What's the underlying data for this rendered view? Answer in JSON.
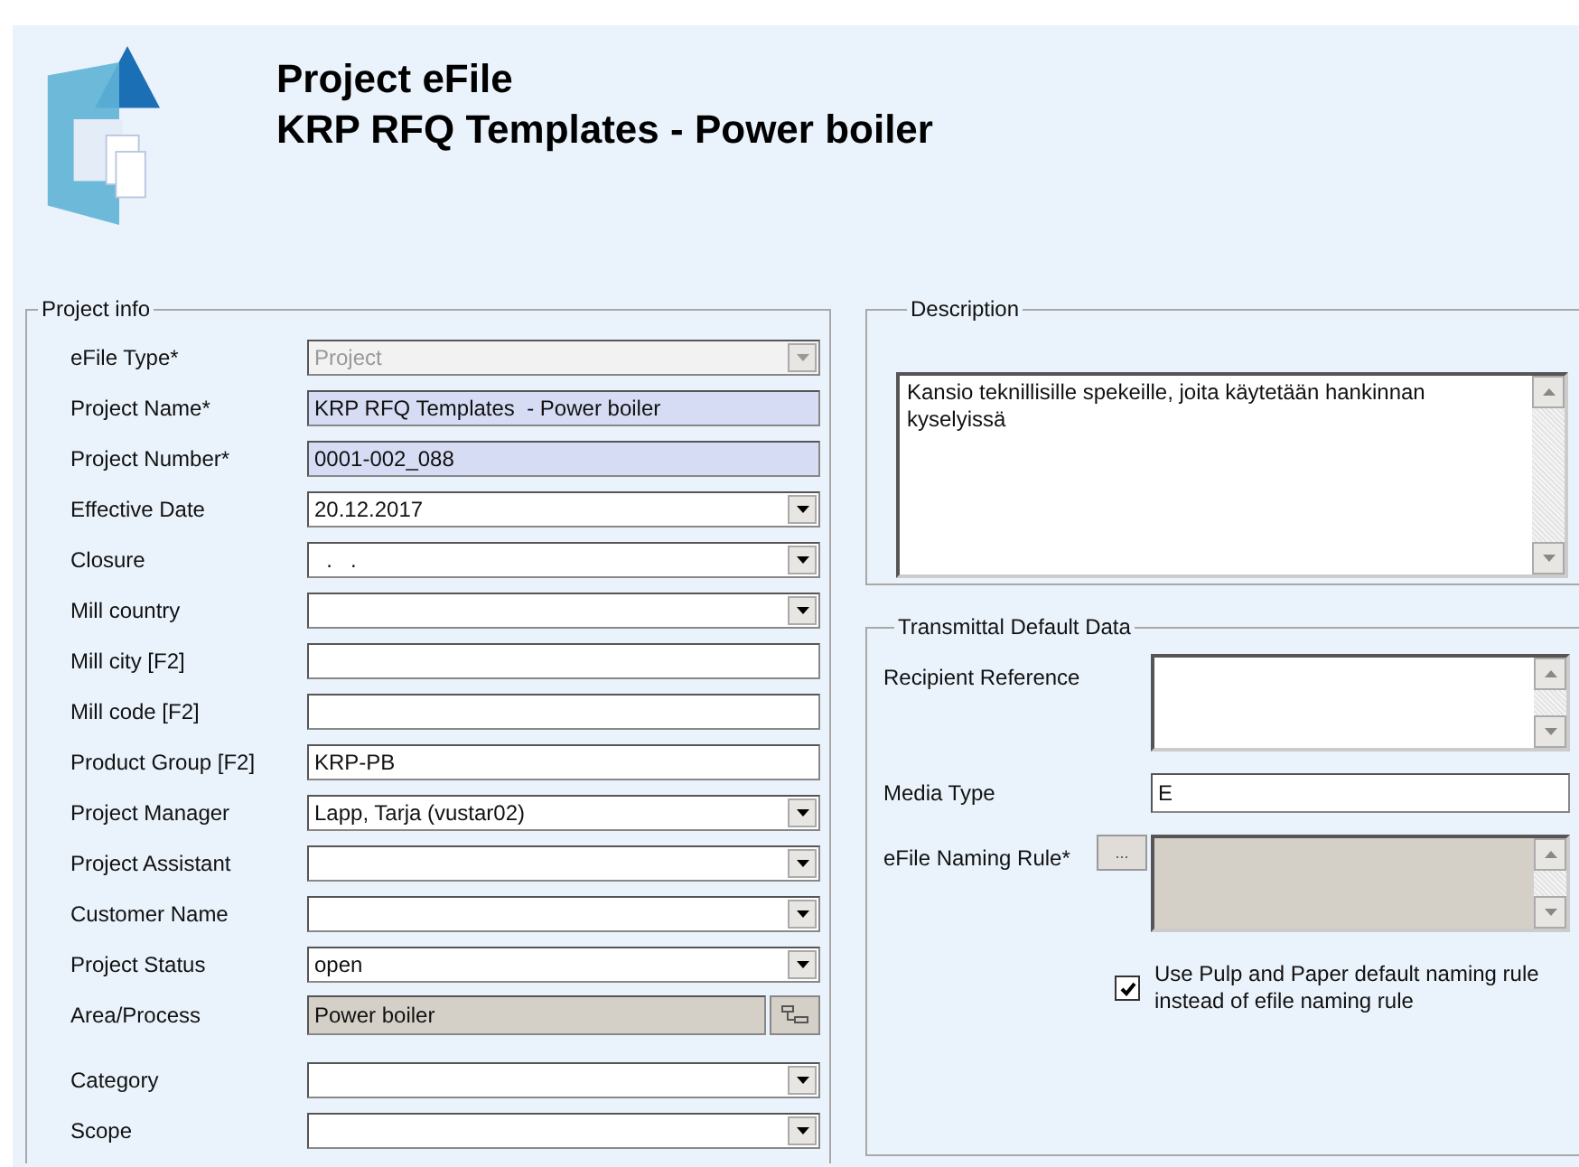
{
  "header": {
    "title": "Project eFile",
    "subtitle": "KRP RFQ Templates  - Power boiler"
  },
  "project_info": {
    "legend": "Project info",
    "fields": [
      {
        "label": "eFile Type*",
        "kind": "dropdown",
        "value": "Project",
        "disabled": true,
        "highlighted": false
      },
      {
        "label": "Project Name*",
        "kind": "text",
        "value": "KRP RFQ Templates  - Power boiler",
        "disabled": false,
        "highlighted": true
      },
      {
        "label": "Project Number*",
        "kind": "text",
        "value": "0001-002_088",
        "disabled": false,
        "highlighted": true
      },
      {
        "label": "Effective Date",
        "kind": "dropdown",
        "value": "20.12.2017",
        "disabled": false,
        "highlighted": false
      },
      {
        "label": "Closure",
        "kind": "dropdown",
        "value": "  .   .",
        "disabled": false,
        "highlighted": false
      },
      {
        "label": "Mill country",
        "kind": "dropdown",
        "disabled": false,
        "highlighted": false
      },
      {
        "label": "Mill city [F2]",
        "kind": "text",
        "disabled": false,
        "highlighted": false
      },
      {
        "label": "Mill code [F2]",
        "kind": "text",
        "disabled": false,
        "highlighted": false
      },
      {
        "label": "Product Group [F2]",
        "kind": "text",
        "value": "KRP-PB",
        "disabled": false,
        "highlighted": false
      },
      {
        "label": "Project Manager",
        "kind": "dropdown",
        "value": "Lapp, Tarja (vustar02)",
        "disabled": false,
        "highlighted": false
      },
      {
        "label": "Project Assistant",
        "kind": "dropdown",
        "disabled": false,
        "highlighted": false
      },
      {
        "label": "Customer Name",
        "kind": "dropdown",
        "disabled": false,
        "highlighted": false
      },
      {
        "label": "Project Status",
        "kind": "dropdown",
        "value": "open",
        "disabled": false,
        "highlighted": false
      },
      {
        "label": "Area/Process",
        "kind": "lookup",
        "value": "Power boiler",
        "disabled": true,
        "highlighted": false
      },
      {
        "label": "Category",
        "kind": "dropdown",
        "disabled": false,
        "highlighted": false
      },
      {
        "label": "Scope",
        "kind": "dropdown",
        "disabled": false,
        "highlighted": false
      }
    ]
  },
  "description": {
    "legend": "Description",
    "value": "Kansio teknillisille spekeille, joita käytetään hankinnan kyselyissä"
  },
  "transmittal": {
    "legend": "Transmittal Default Data",
    "recipient_reference": {
      "label": "Recipient Reference"
    },
    "media_type": {
      "label": "Media Type",
      "value": "E"
    },
    "naming_rule": {
      "label": "eFile Naming Rule*",
      "button": "..."
    },
    "default_rule": {
      "label": "Use Pulp and Paper default naming rule instead of efile naming rule",
      "checked": true
    }
  }
}
